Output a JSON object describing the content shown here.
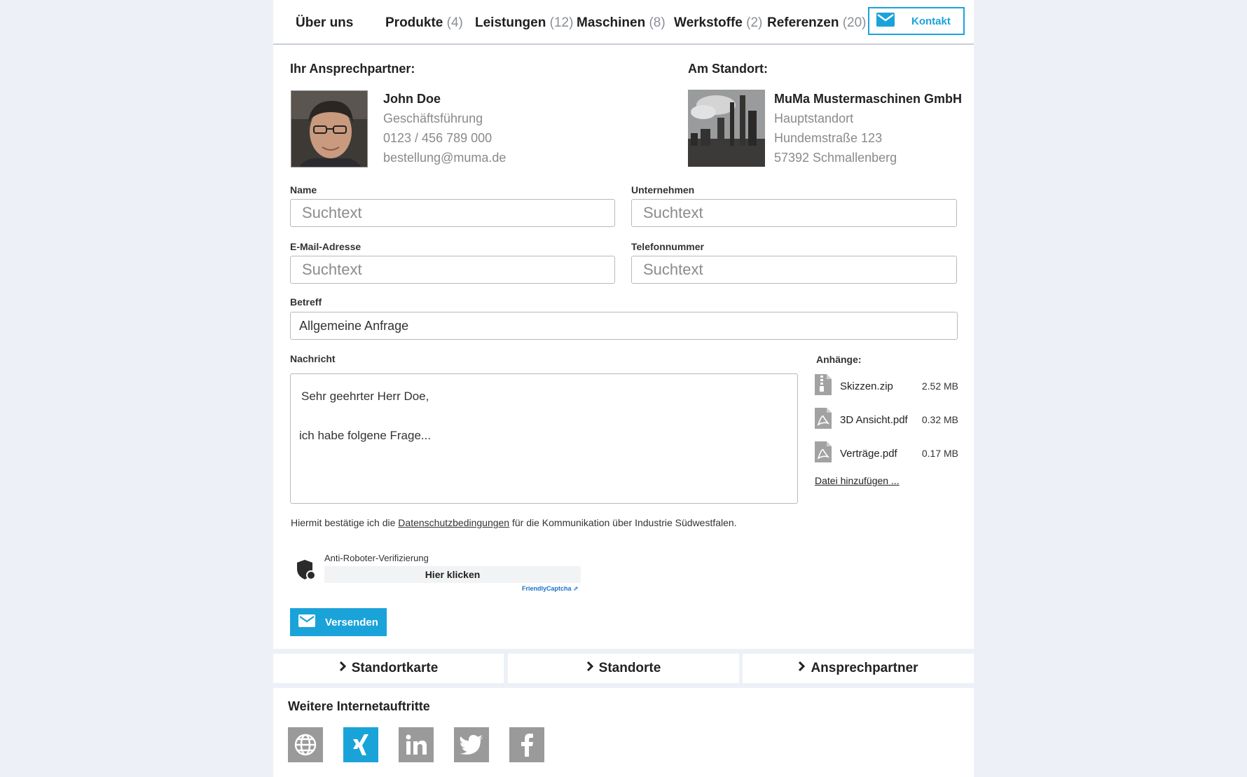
{
  "nav": {
    "items": [
      {
        "label": "Über uns",
        "count": ""
      },
      {
        "label": "Produkte",
        "count": "(4)"
      },
      {
        "label": "Leistungen",
        "count": "(12)"
      },
      {
        "label": "Maschinen",
        "count": "(8)"
      },
      {
        "label": "Werkstoffe",
        "count": "(2)"
      },
      {
        "label": "Referenzen",
        "count": "(20)"
      }
    ],
    "contact_button": "Kontakt"
  },
  "contact": {
    "title": "Ihr Ansprechpartner:",
    "name": "John Doe",
    "role": "Geschäftsführung",
    "phone": "0123 / 456 789 000",
    "email": "bestellung@muma.de"
  },
  "location": {
    "title": "Am Standort:",
    "company": "MuMa Mustermaschinen GmbH",
    "type": "Hauptstandort",
    "street": "Hundemstraße 123",
    "city": "57392 Schmallenberg"
  },
  "form": {
    "name_label": "Name",
    "name_placeholder": "Suchtext",
    "company_label": "Unternehmen",
    "company_placeholder": "Suchtext",
    "email_label": "E-Mail-Adresse",
    "email_placeholder": "Suchtext",
    "phone_label": "Telefonnummer",
    "phone_placeholder": "Suchtext",
    "subject_label": "Betreff",
    "subject_value": "Allgemeine Anfrage",
    "message_label": "Nachricht",
    "message_line1": "Sehr geehrter Herr Doe,",
    "message_line2": "ich habe folgene Frage..."
  },
  "attachments": {
    "title": "Anhänge:",
    "files": [
      {
        "name": "Skizzen.zip",
        "size": "2.52 MB",
        "icon": "zip-file-icon"
      },
      {
        "name": "3D Ansicht.pdf",
        "size": "0.32 MB",
        "icon": "pdf-file-icon"
      },
      {
        "name": "Verträge.pdf",
        "size": "0.17 MB",
        "icon": "pdf-file-icon"
      }
    ],
    "add_link": "Datei hinzufügen ..."
  },
  "consent": {
    "before": "Hiermit bestätige ich die ",
    "link": "Datenschutzbedingungen",
    "after": " für die Kommunikation über Industrie Südwestfalen."
  },
  "captcha": {
    "label": "Anti-Roboter-Verifizierung",
    "button": "Hier klicken",
    "brand": "FriendlyCaptcha ⇗"
  },
  "send_button": "Versenden",
  "tabs": [
    "Standortkarte",
    "Standorte",
    "Ansprechpartner"
  ],
  "footer": {
    "title": "Weitere Internetauftritte",
    "icons": [
      "globe-icon",
      "xing-icon",
      "linkedin-icon",
      "twitter-icon",
      "facebook-icon"
    ]
  },
  "colors": {
    "accent": "#1aa3d9",
    "social_grey": "#9a9a9a",
    "page_bg": "#edf1f7"
  }
}
